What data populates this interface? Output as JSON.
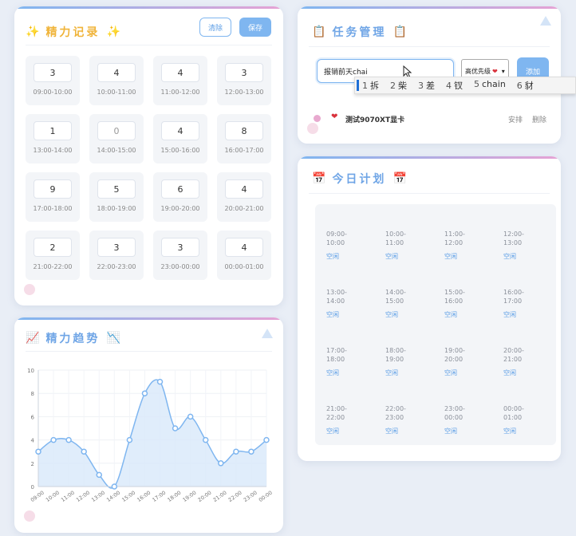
{
  "energy_record": {
    "title": "精力记录",
    "emoji_left": "✨",
    "emoji_right": "✨",
    "clear_label": "清除",
    "save_label": "保存",
    "slots": [
      {
        "value": "3",
        "time": "09:00-10:00"
      },
      {
        "value": "4",
        "time": "10:00-11:00"
      },
      {
        "value": "4",
        "time": "11:00-12:00"
      },
      {
        "value": "3",
        "time": "12:00-13:00"
      },
      {
        "value": "1",
        "time": "13:00-14:00"
      },
      {
        "value": "0",
        "time": "14:00-15:00"
      },
      {
        "value": "4",
        "time": "15:00-16:00"
      },
      {
        "value": "8",
        "time": "16:00-17:00"
      },
      {
        "value": "9",
        "time": "17:00-18:00"
      },
      {
        "value": "5",
        "time": "18:00-19:00"
      },
      {
        "value": "6",
        "time": "19:00-20:00"
      },
      {
        "value": "4",
        "time": "20:00-21:00"
      },
      {
        "value": "2",
        "time": "21:00-22:00"
      },
      {
        "value": "3",
        "time": "22:00-23:00"
      },
      {
        "value": "3",
        "time": "23:00-00:00"
      },
      {
        "value": "4",
        "time": "00:00-01:00"
      }
    ]
  },
  "energy_trend": {
    "title": "精力趋势",
    "emoji_left": "📈",
    "emoji_right": "📉"
  },
  "chart_data": {
    "type": "line",
    "x": [
      "09:00",
      "10:00",
      "11:00",
      "12:00",
      "13:00",
      "14:00",
      "15:00",
      "16:00",
      "17:00",
      "18:00",
      "19:00",
      "20:00",
      "21:00",
      "22:00",
      "23:00",
      "00:00"
    ],
    "series": [
      {
        "values": [
          3,
          4,
          4,
          3,
          1,
          0,
          4,
          8,
          9,
          5,
          6,
          4,
          2,
          3,
          3,
          4
        ]
      }
    ],
    "ylim": [
      0,
      10
    ],
    "yticks": [
      0,
      2,
      4,
      6,
      8,
      10
    ],
    "grid": true,
    "line_color": "#7fb6f0",
    "fill_color": "#d8e8fa"
  },
  "task_manager": {
    "title": "任务管理",
    "emoji_left": "📋",
    "emoji_right": "📋",
    "input_value": "报销前天chai",
    "priority_label": "高优先级",
    "add_label": "添加",
    "ime_candidates": [
      {
        "num": "1",
        "text": "拆"
      },
      {
        "num": "2",
        "text": "柴"
      },
      {
        "num": "3",
        "text": "差"
      },
      {
        "num": "4",
        "text": "钗"
      },
      {
        "num": "5",
        "text": "chain"
      },
      {
        "num": "6",
        "text": "豺"
      }
    ],
    "tasks": [
      {
        "name": "测试9070XT显卡",
        "schedule_label": "安排",
        "delete_label": "删除"
      }
    ]
  },
  "today_plan": {
    "title": "今日计划",
    "emoji_left": "📅",
    "emoji_right": "📅",
    "slots": [
      {
        "time": "09:00-10:00",
        "status": "空闲"
      },
      {
        "time": "10:00-11:00",
        "status": "空闲"
      },
      {
        "time": "11:00-12:00",
        "status": "空闲"
      },
      {
        "time": "12:00-13:00",
        "status": "空闲"
      },
      {
        "time": "13:00-14:00",
        "status": "空闲"
      },
      {
        "time": "14:00-15:00",
        "status": "空闲"
      },
      {
        "time": "15:00-16:00",
        "status": "空闲"
      },
      {
        "time": "16:00-17:00",
        "status": "空闲"
      },
      {
        "time": "17:00-18:00",
        "status": "空闲"
      },
      {
        "time": "18:00-19:00",
        "status": "空闲"
      },
      {
        "time": "19:00-20:00",
        "status": "空闲"
      },
      {
        "time": "20:00-21:00",
        "status": "空闲"
      },
      {
        "time": "21:00-22:00",
        "status": "空闲"
      },
      {
        "time": "22:00-23:00",
        "status": "空闲"
      },
      {
        "time": "23:00-00:00",
        "status": "空闲"
      },
      {
        "time": "00:00-01:00",
        "status": "空闲"
      }
    ]
  }
}
